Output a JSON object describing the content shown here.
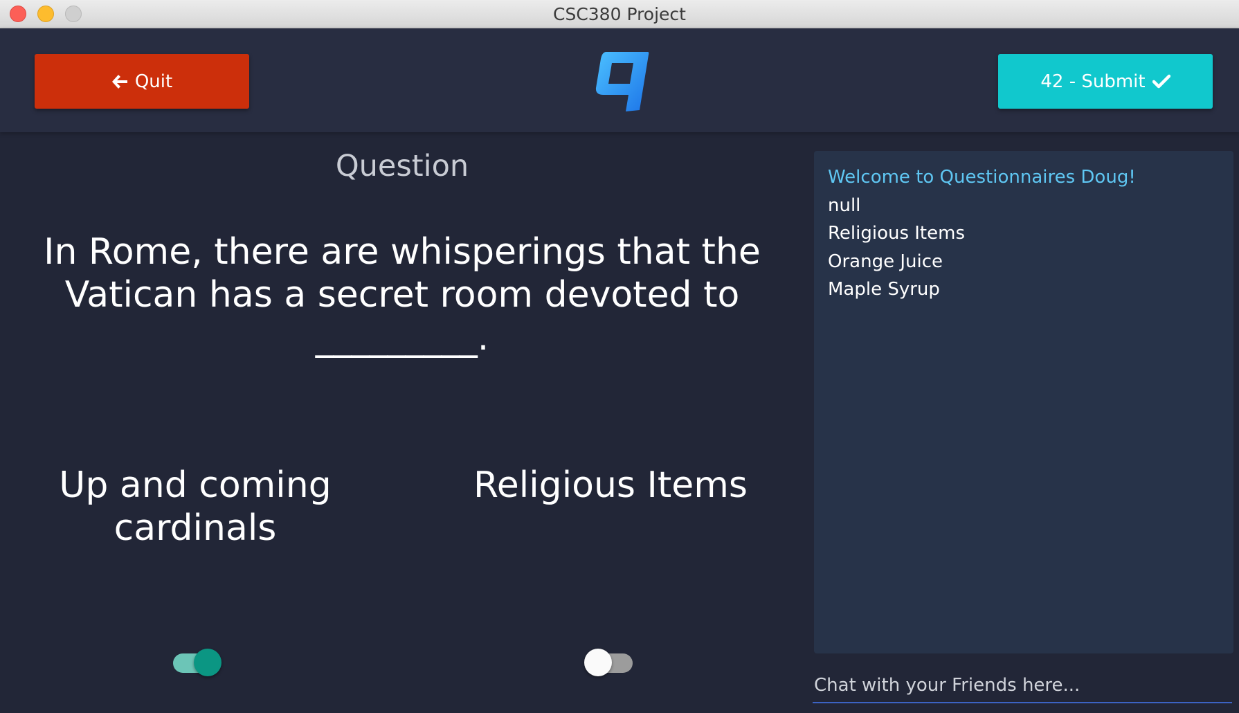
{
  "window": {
    "title": "CSC380 Project"
  },
  "header": {
    "quit_label": "Quit",
    "submit_label": "42 - Submit",
    "logo_icon": "q-logo-icon"
  },
  "question": {
    "heading": "Question",
    "text": "In Rome, there are whisperings that the Vatican has a secret room devoted to _________."
  },
  "answers": [
    {
      "label": "Up and coming cardinals",
      "selected": true
    },
    {
      "label": "Religious Items",
      "selected": false
    }
  ],
  "chat": {
    "messages": [
      "Welcome to Questionnaires Doug!",
      "null",
      "Religious Items",
      "Orange Juice",
      "Maple Syrup"
    ],
    "placeholder": "Chat with your Friends here..."
  },
  "colors": {
    "background": "#222637",
    "header": "#282d41",
    "quit": "#cc2f0b",
    "submit": "#11c8cd",
    "toggle_on": "#0b9683",
    "chat_panel": "#273349",
    "welcome_text": "#5fc7f3"
  }
}
